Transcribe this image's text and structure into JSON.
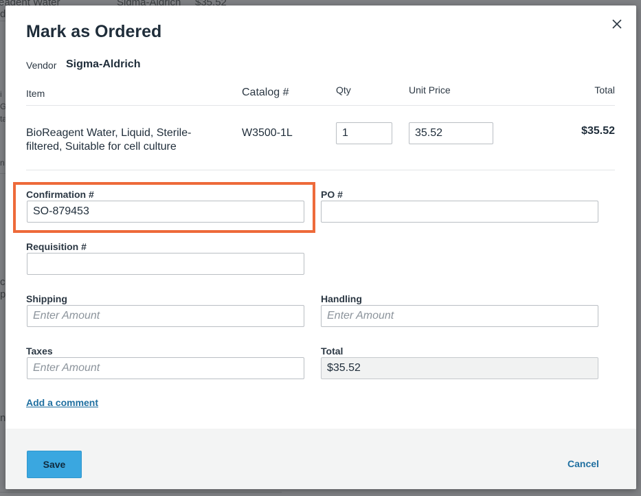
{
  "background": {
    "row_item": "eagent Water",
    "row_vendor": "Sigma-Aldrich",
    "row_price": "$35.52",
    "fragments": [
      "d",
      "i",
      "G",
      "ta",
      "n",
      "c",
      "p",
      "n"
    ]
  },
  "modal": {
    "title": "Mark as Ordered",
    "close_icon": "close-icon",
    "vendor": {
      "label": "Vendor",
      "value": "Sigma-Aldrich"
    },
    "columns": {
      "item": "Item",
      "catalog": "Catalog #",
      "qty": "Qty",
      "unit_price": "Unit Price",
      "total": "Total"
    },
    "line_item": {
      "name": "BioReagent Water, Liquid, Sterile-filtered, Suitable for cell culture",
      "catalog": "W3500-1L",
      "qty": "1",
      "unit_price": "35.52",
      "total": "$35.52"
    },
    "fields": {
      "confirmation": {
        "label": "Confirmation #",
        "value": "SO-879453",
        "placeholder": ""
      },
      "po": {
        "label": "PO #",
        "value": "",
        "placeholder": ""
      },
      "requisition": {
        "label": "Requisition #",
        "value": "",
        "placeholder": ""
      },
      "shipping": {
        "label": "Shipping",
        "value": "",
        "placeholder": "Enter Amount"
      },
      "handling": {
        "label": "Handling",
        "value": "",
        "placeholder": "Enter Amount"
      },
      "taxes": {
        "label": "Taxes",
        "value": "",
        "placeholder": "Enter Amount"
      },
      "total": {
        "label": "Total",
        "value": "$35.52",
        "placeholder": ""
      }
    },
    "add_comment": "Add a comment",
    "footer": {
      "save": "Save",
      "cancel": "Cancel"
    }
  },
  "colors": {
    "highlight": "#ee6a3a",
    "primary_button": "#3aa7e0",
    "link": "#1f6fa0"
  }
}
